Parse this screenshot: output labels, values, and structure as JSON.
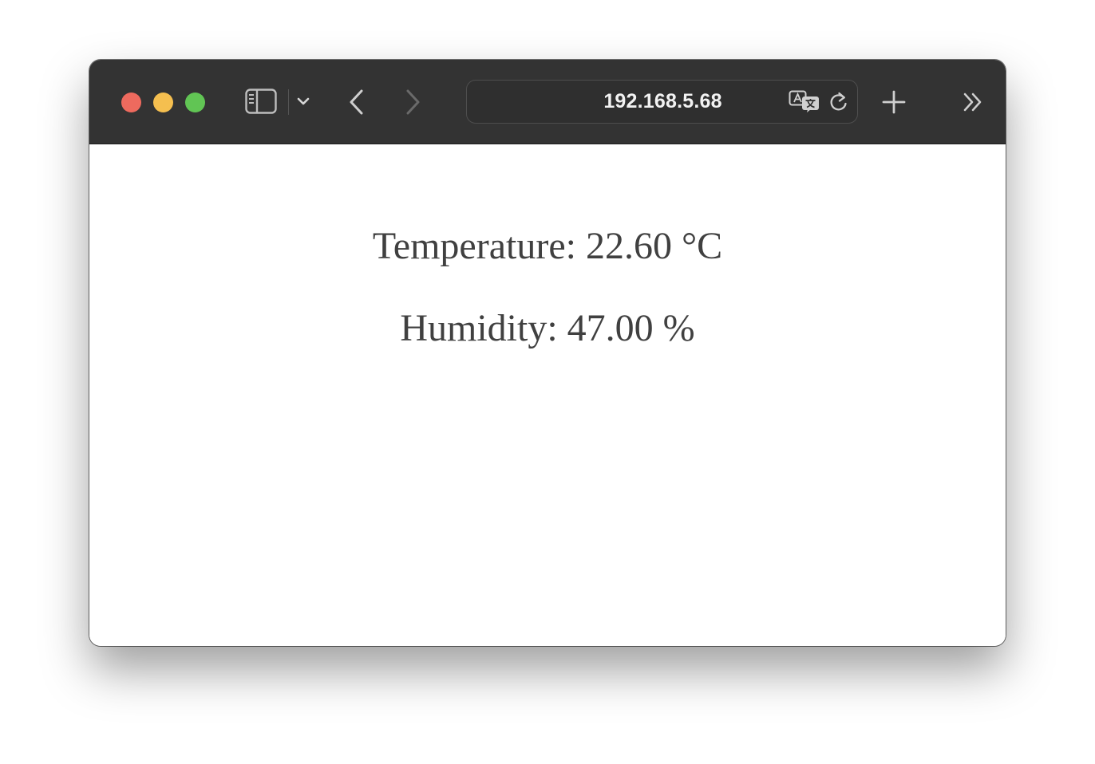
{
  "browser": {
    "address_bar": {
      "url": "192.168.5.68"
    },
    "toolbar_icons": [
      "sidebar-icon",
      "chevron-down-icon",
      "back-arrow-icon",
      "forward-arrow-icon",
      "translate-icon",
      "reload-icon",
      "plus-icon",
      "double-chevron-right-icon"
    ],
    "traffic_light_colors": {
      "close": "#ee6a5e",
      "minimize": "#f5bf4f",
      "maximize": "#61c554"
    }
  },
  "page": {
    "temperature_text": "Temperature: 22.60 °C",
    "humidity_text": "Humidity: 47.00 %"
  }
}
